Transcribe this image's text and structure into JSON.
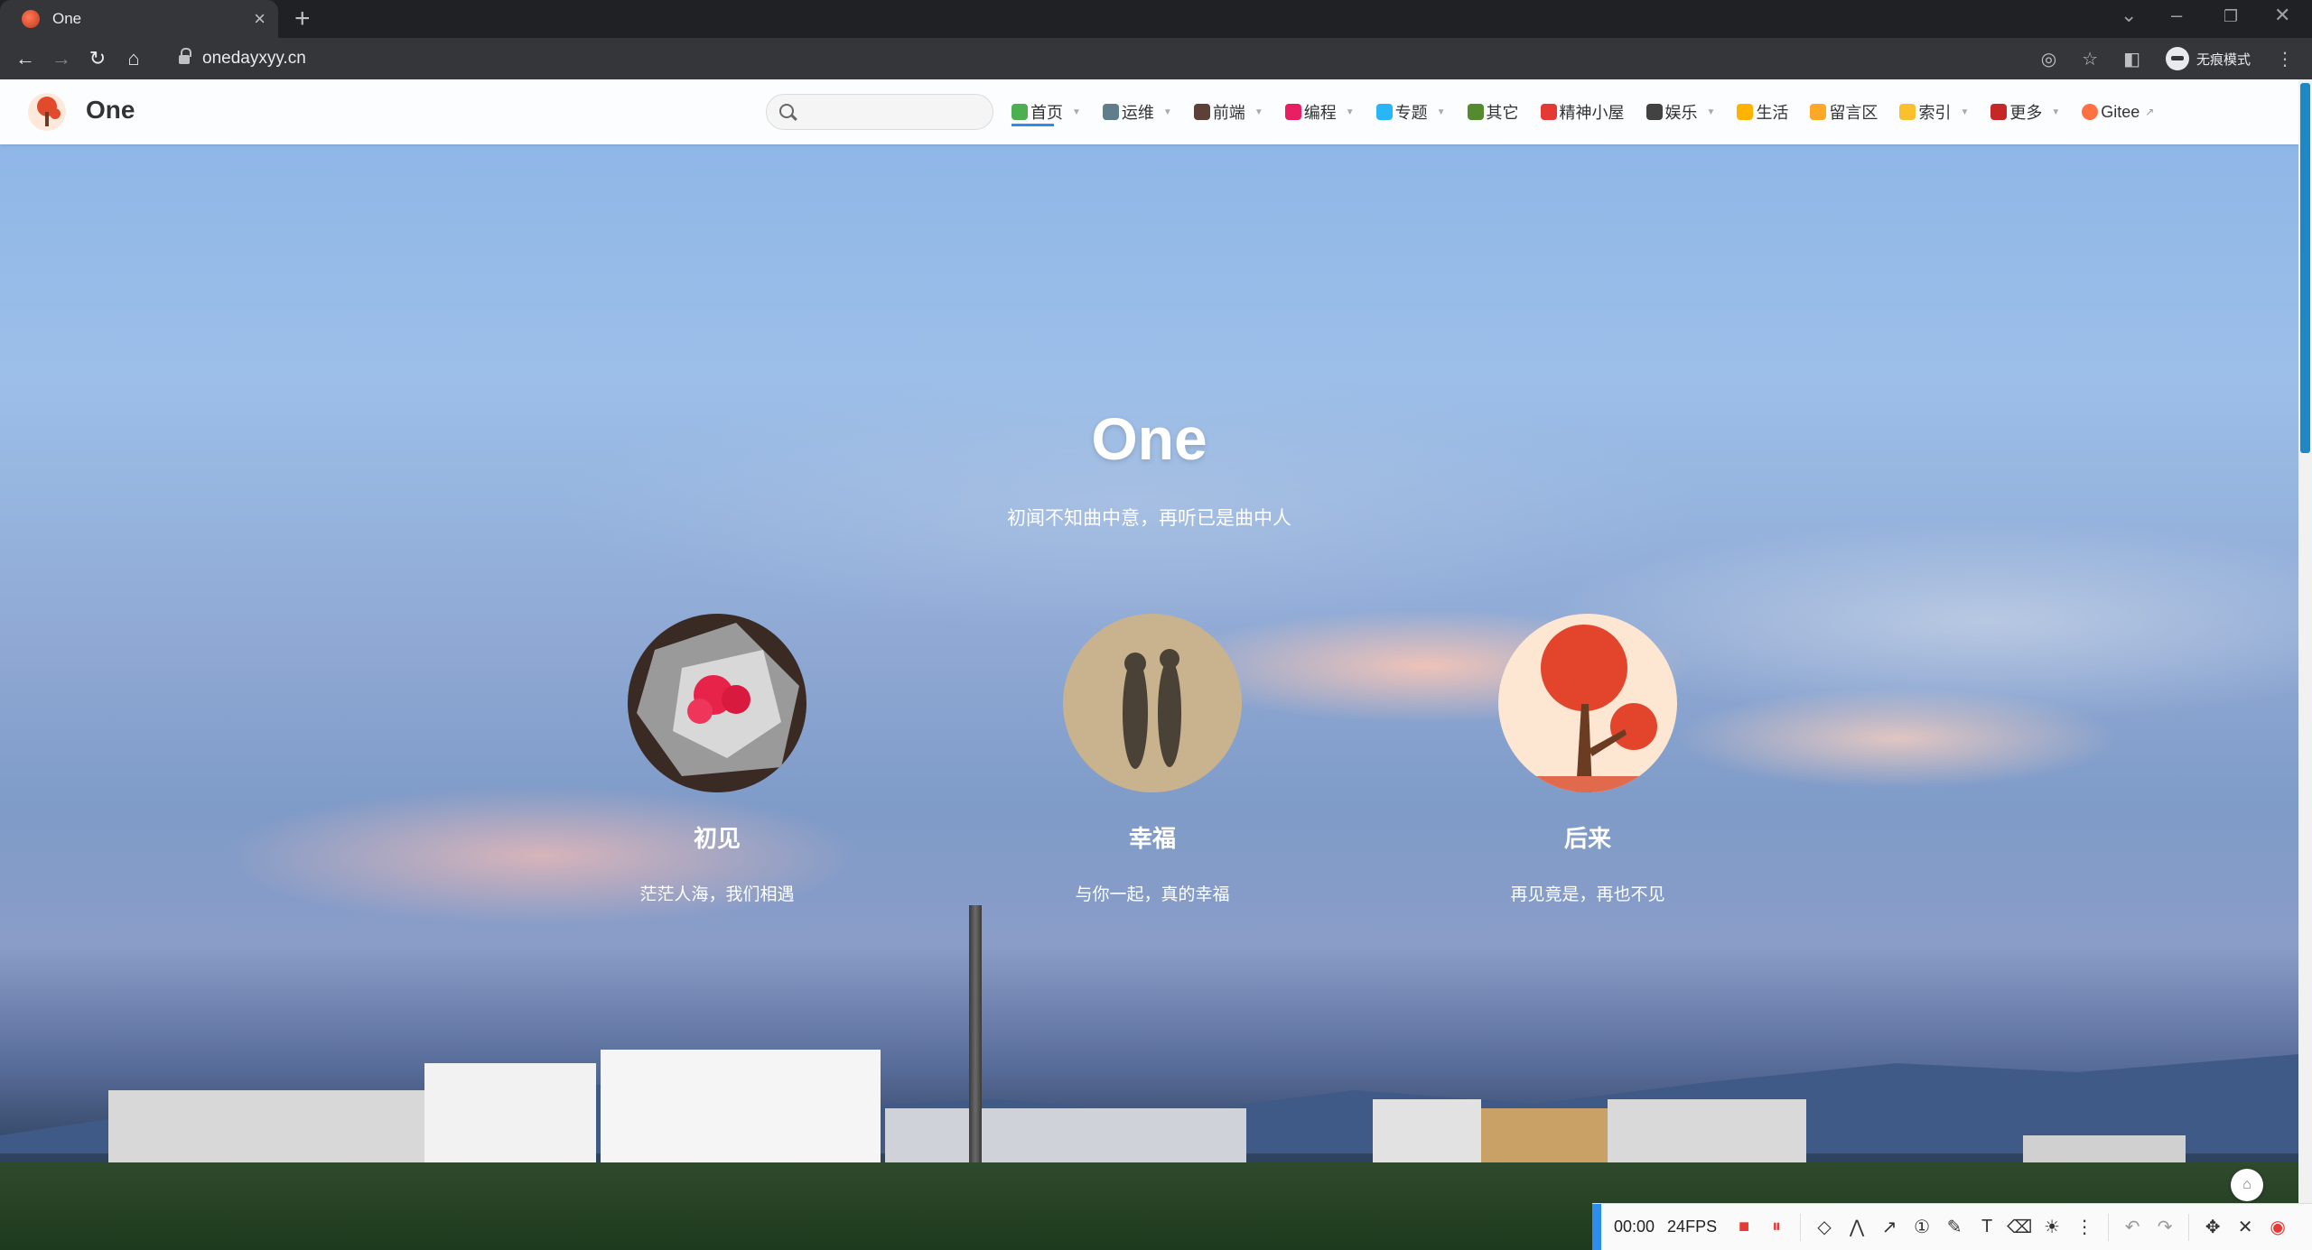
{
  "browser": {
    "tab_title": "One",
    "url": "onedayxyy.cn",
    "incognito_label": "无痕模式"
  },
  "site": {
    "name": "One",
    "search_placeholder": "",
    "menu": [
      {
        "label": "首页",
        "icon": "house-icon",
        "color": "#4caf50",
        "dropdown": true,
        "active": true
      },
      {
        "label": "运维",
        "icon": "tools-icon",
        "color": "#607d8b",
        "dropdown": true
      },
      {
        "label": "前端",
        "icon": "package-icon",
        "color": "#5d4037",
        "dropdown": true
      },
      {
        "label": "编程",
        "icon": "ribbon-icon",
        "color": "#e91e63",
        "dropdown": true
      },
      {
        "label": "专题",
        "icon": "gem-icon",
        "color": "#29b6f6",
        "dropdown": true
      },
      {
        "label": "其它",
        "icon": "turtle-icon",
        "color": "#558b2f",
        "dropdown": false
      },
      {
        "label": "精神小屋",
        "icon": "heart-icon",
        "color": "#e53935",
        "dropdown": false
      },
      {
        "label": "娱乐",
        "icon": "clapper-icon",
        "color": "#424242",
        "dropdown": true
      },
      {
        "label": "生活",
        "icon": "star-icon",
        "color": "#ffb300",
        "dropdown": false
      },
      {
        "label": "留言区",
        "icon": "ear-icon",
        "color": "#ffa726",
        "dropdown": false
      },
      {
        "label": "索引",
        "icon": "lemon-icon",
        "color": "#fbc02d",
        "dropdown": true
      },
      {
        "label": "更多",
        "icon": "rose-icon",
        "color": "#c62828",
        "dropdown": true
      },
      {
        "label": "Gitee",
        "icon": "orange-icon",
        "color": "#ff7043",
        "dropdown": false,
        "external": true
      }
    ]
  },
  "hero": {
    "title": "One",
    "subtitle": "初闻不知曲中意，再听已是曲中人"
  },
  "cards": [
    {
      "title": "初见",
      "desc": "茫茫人海，我们相遇"
    },
    {
      "title": "幸福",
      "desc": "与你一起，真的幸福"
    },
    {
      "title": "后来",
      "desc": "再见竟是，再也不见"
    }
  ],
  "recorder": {
    "time": "00:00",
    "fps": "24FPS"
  }
}
